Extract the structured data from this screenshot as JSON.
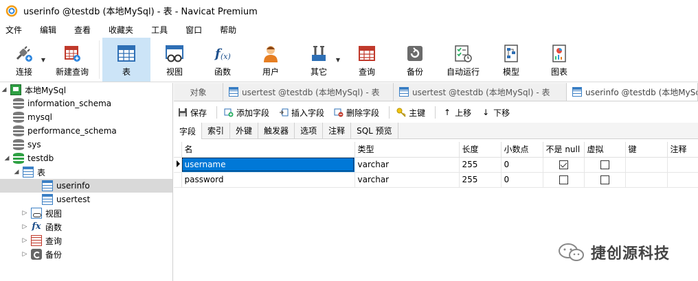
{
  "window": {
    "title": "userinfo @testdb (本地MySql) - 表 - Navicat Premium"
  },
  "menu": [
    "文件",
    "编辑",
    "查看",
    "收藏夹",
    "工具",
    "窗口",
    "帮助"
  ],
  "toolbar": [
    {
      "label": "连接",
      "icon": "plug-icon"
    },
    {
      "label": "新建查询",
      "icon": "new-query-icon"
    },
    {
      "label": "表",
      "icon": "table-icon",
      "active": true
    },
    {
      "label": "视图",
      "icon": "view-icon"
    },
    {
      "label": "函数",
      "icon": "function-icon"
    },
    {
      "label": "用户",
      "icon": "user-icon"
    },
    {
      "label": "其它",
      "icon": "tools-icon"
    },
    {
      "label": "查询",
      "icon": "query-icon"
    },
    {
      "label": "备份",
      "icon": "backup-icon"
    },
    {
      "label": "自动运行",
      "icon": "schedule-icon"
    },
    {
      "label": "模型",
      "icon": "model-icon"
    },
    {
      "label": "图表",
      "icon": "chart-icon"
    }
  ],
  "tree": {
    "connection": "本地MySql",
    "databases": [
      "information_schema",
      "mysql",
      "performance_schema",
      "sys",
      "testdb"
    ],
    "tables_folder": "表",
    "tables": [
      "userinfo",
      "usertest"
    ],
    "folders": [
      "视图",
      "函数",
      "查询",
      "备份"
    ]
  },
  "tabs": [
    "对象",
    "usertest @testdb (本地MySql) - 表",
    "usertest @testdb (本地MySql) - 表",
    "userinfo @testdb (本地MySql) - 表"
  ],
  "designer_toolbar": {
    "save": "保存",
    "add_field": "添加字段",
    "insert_field": "插入字段",
    "delete_field": "删除字段",
    "primary_key": "主键",
    "move_up": "上移",
    "move_down": "下移"
  },
  "subtabs": [
    "字段",
    "索引",
    "外键",
    "触发器",
    "选项",
    "注释",
    "SQL 预览"
  ],
  "grid": {
    "columns": [
      "名",
      "类型",
      "长度",
      "小数点",
      "不是 null",
      "虚拟",
      "键",
      "注释"
    ],
    "rows": [
      {
        "name": "username",
        "type": "varchar",
        "length": "255",
        "decimals": "0",
        "not_null": true,
        "virtual": false
      },
      {
        "name": "password",
        "type": "varchar",
        "length": "255",
        "decimals": "0",
        "not_null": false,
        "virtual": false
      }
    ]
  },
  "watermark": "捷创源科技"
}
